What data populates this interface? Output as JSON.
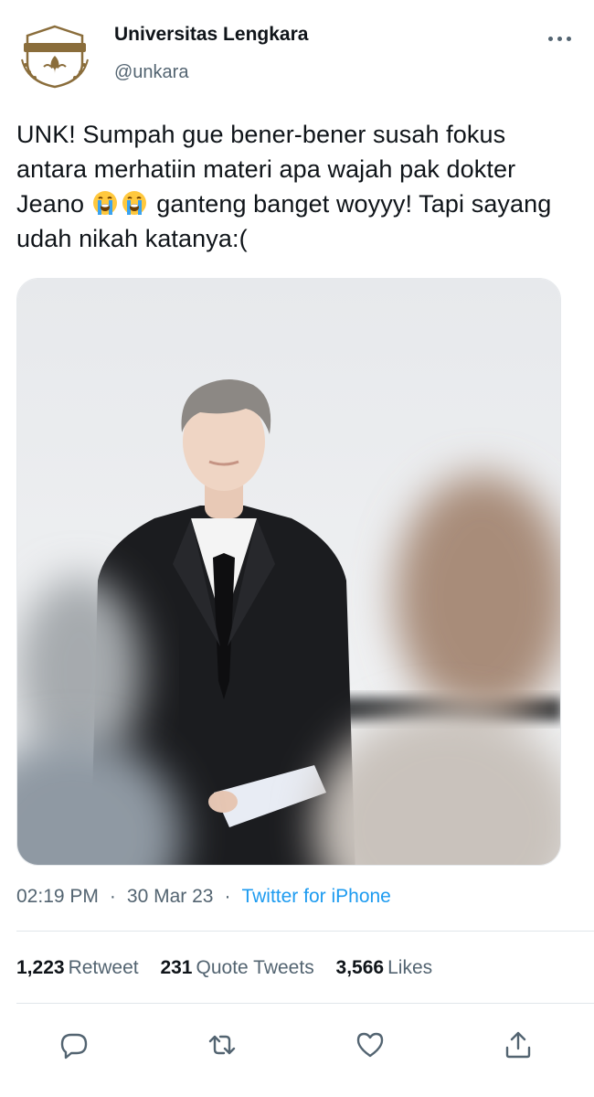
{
  "account": {
    "name": "Universitas Lengkara",
    "handle": "@unkara"
  },
  "tweet": {
    "text_part1": "UNK! Sumpah gue bener-bener susah fokus antara merhatiin materi apa wajah pak dokter Jeano ",
    "text_part2": " ganteng banget woyyy! Tapi sayang udah nikah katanya:(",
    "emojis": [
      "loudly-crying-face",
      "loudly-crying-face"
    ]
  },
  "meta": {
    "time": "02:19 PM",
    "date": "30 Mar 23",
    "separator": "·",
    "source": "Twitter for iPhone"
  },
  "stats": {
    "retweets_count": "1,223",
    "retweets_label": "Retweet",
    "quotes_count": "231",
    "quotes_label": "Quote Tweets",
    "likes_count": "3,566",
    "likes_label": "Likes"
  },
  "actions": [
    "reply-icon",
    "retweet-icon",
    "like-icon",
    "share-icon"
  ],
  "colors": {
    "link": "#1d9bf0",
    "secondary_text": "#536471",
    "primary_text": "#0f1419",
    "avatar_brown": "#8a6d3b"
  }
}
